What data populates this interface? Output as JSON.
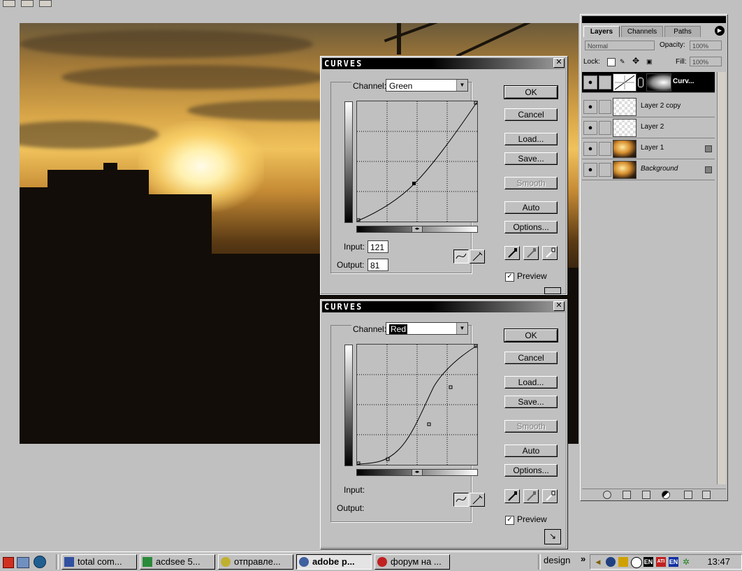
{
  "palette": {
    "tabs": [
      "Layers",
      "Channels",
      "Paths"
    ],
    "blend_mode": "Normal",
    "opacity_label": "Opacity:",
    "opacity_value": "100%",
    "lock_label": "Lock:",
    "fill_label": "Fill:",
    "fill_value": "100%",
    "layers": [
      {
        "name": "Curv...",
        "active": true
      },
      {
        "name": "Layer 2 copy",
        "active": false
      },
      {
        "name": "Layer 2",
        "active": false
      },
      {
        "name": "Layer 1",
        "active": false
      },
      {
        "name": "Background",
        "active": false
      }
    ]
  },
  "dialog_green": {
    "title": "CURVES",
    "channel_label": "Channel:",
    "channel_value": "Green",
    "input_label": "Input:",
    "input_value": "121",
    "output_label": "Output:",
    "output_value": "81",
    "buttons": {
      "ok": "OK",
      "cancel": "Cancel",
      "load": "Load...",
      "save": "Save...",
      "smooth": "Smooth",
      "auto": "Auto",
      "options": "Options..."
    },
    "preview_label": "Preview"
  },
  "dialog_red": {
    "title": "CURVES",
    "channel_label": "Channel:",
    "channel_value": "Red",
    "input_label": "Input:",
    "output_label": "Output:",
    "buttons": {
      "ok": "OK",
      "cancel": "Cancel",
      "load": "Load...",
      "save": "Save...",
      "smooth": "Smooth",
      "auto": "Auto",
      "options": "Options..."
    },
    "preview_label": "Preview"
  },
  "taskbar": {
    "items": [
      {
        "label": "total com...",
        "active": false
      },
      {
        "label": "acdsee 5...",
        "active": false
      },
      {
        "label": "отправле...",
        "active": false
      },
      {
        "label": "adobe p...",
        "active": true
      },
      {
        "label": "форум на ...",
        "active": false
      }
    ],
    "toolbar_label": "design",
    "toolbar_chevron": "»",
    "lang": "EN",
    "clock": "13:47"
  }
}
